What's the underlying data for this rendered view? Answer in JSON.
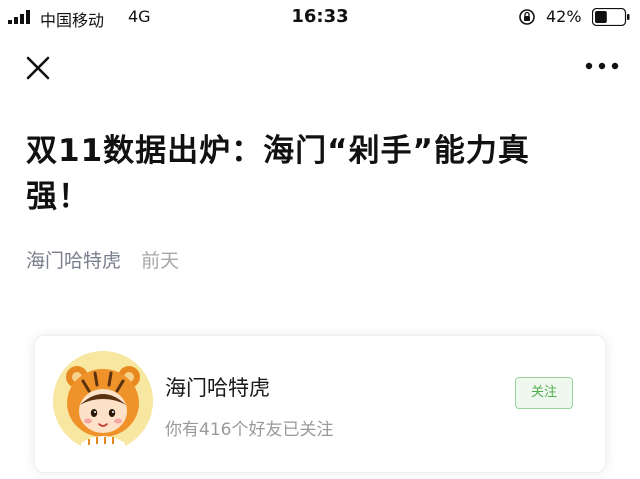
{
  "status_bar": {
    "carrier": "中国移动",
    "network": "4G",
    "time": "16:33",
    "battery_percent": "42%",
    "battery_level": 0.42
  },
  "nav": {
    "close_icon": "close-icon",
    "more_icon": "more-dots-icon"
  },
  "article": {
    "title": "双11数据出炉：海门“剁手”能力真强！",
    "author": "海门哈特虎",
    "date": "前天"
  },
  "account_card": {
    "name": "海门哈特虎",
    "followers_text": "你有416个好友已关注",
    "follow_button_label": "关注",
    "avatar_icon": "tiger-mascot-avatar"
  },
  "colors": {
    "text_primary": "#111111",
    "meta_gray": "#8a8a8a",
    "follow_green": "#4fae4f",
    "avatar_bg": "#f7e7a0"
  }
}
